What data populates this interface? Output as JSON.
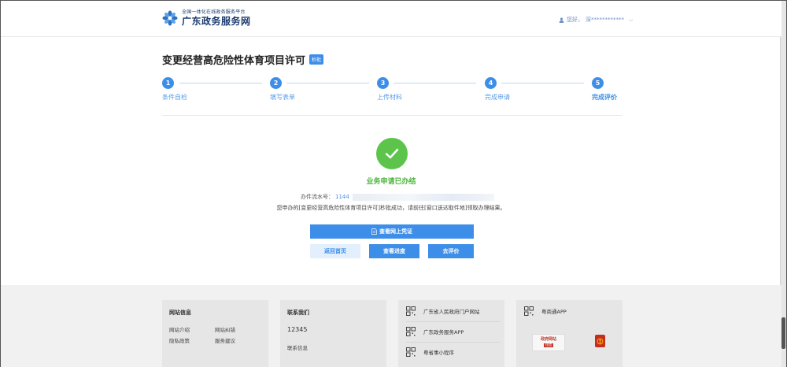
{
  "header": {
    "logo_sub": "全国一体化在线政务服务平台",
    "logo_main": "广东政务服务网",
    "greeting": "您好，",
    "user_masked": "深************"
  },
  "page": {
    "title": "变更经营高危险性体育项目许可",
    "tag": "秒批"
  },
  "steps": [
    {
      "num": "1",
      "label": "条件自检"
    },
    {
      "num": "2",
      "label": "填写表单"
    },
    {
      "num": "3",
      "label": "上传材料"
    },
    {
      "num": "4",
      "label": "完成申请"
    },
    {
      "num": "5",
      "label": "完成评价"
    }
  ],
  "result": {
    "status": "业务申请已办结",
    "serial_label": "办件流水号：",
    "serial_value": "1144",
    "message": "您申办的[变更经营高危险性体育项目许可]秒批成功，请前往[窗口送达取件地]领取办理结果。"
  },
  "buttons": {
    "view_cert": "查看网上凭证",
    "back_home": "返回首页",
    "view_progress": "查看进度",
    "evaluate": "去评价"
  },
  "footer": {
    "site_info": {
      "title": "网站信息",
      "links": [
        "网站介绍",
        "网站纠错",
        "隐私政策",
        "服务建议"
      ]
    },
    "contact": {
      "title": "联系我们",
      "phone": "12345",
      "link": "联系信息"
    },
    "portals": [
      "广东省人民政府门户网站",
      "广东政务服务APP",
      "粤省事小程序"
    ],
    "apps": {
      "title": "粤商通APP",
      "badge_line1": "政府网站",
      "badge_line2": "找错"
    }
  },
  "colors": {
    "primary": "#3d8ee8",
    "success": "#5cc44b",
    "footer_bg": "#f1f1f1"
  }
}
